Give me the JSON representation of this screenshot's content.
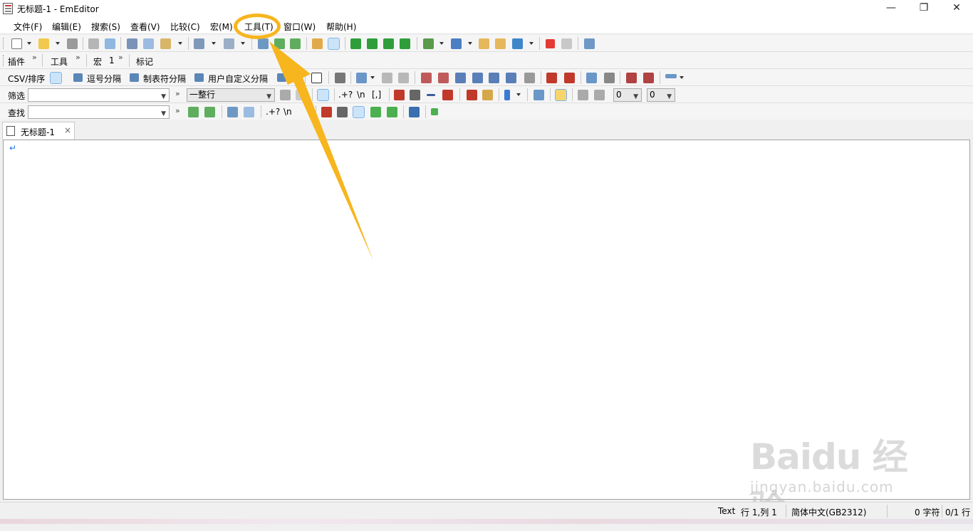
{
  "window": {
    "title": "无标题-1 - EmEditor",
    "minimize": "—",
    "restore": "❐",
    "close": "✕"
  },
  "menu": [
    "文件(F)",
    "编辑(E)",
    "搜索(S)",
    "查看(V)",
    "比较(C)",
    "宏(M)",
    "工具(T)",
    "窗口(W)",
    "帮助(H)"
  ],
  "bars": {
    "plugins": "插件",
    "tools": "工具",
    "macros": "宏",
    "macro_count": "1",
    "markers": "标记",
    "csv": "CSV/排序",
    "comma": "逗号分隔",
    "tab_sep": "制表符分隔",
    "user_sep": "用户自定义分隔"
  },
  "filter": {
    "label": "筛选",
    "value": "",
    "scope": "一整行",
    "regex": ".+?",
    "newline": "\\n",
    "escape": "[,]",
    "num1": "0",
    "num2": "0"
  },
  "find": {
    "label": "查找",
    "value": "",
    "regex": ".+?",
    "newline": "\\n"
  },
  "tab": {
    "label": "无标题-1",
    "close": "×"
  },
  "editor": {
    "eol": "↵"
  },
  "status": {
    "mode": "Text",
    "position": "行 1,列 1",
    "encoding": "简体中文(GB2312)",
    "chars": "0 字符",
    "lines": "0/1 行"
  },
  "watermark": {
    "brand": "Baidu 经验",
    "url": "jingyan.baidu.com"
  },
  "colors": {
    "annotation": "#f7b51e",
    "selected_button": "#cce4f7"
  }
}
